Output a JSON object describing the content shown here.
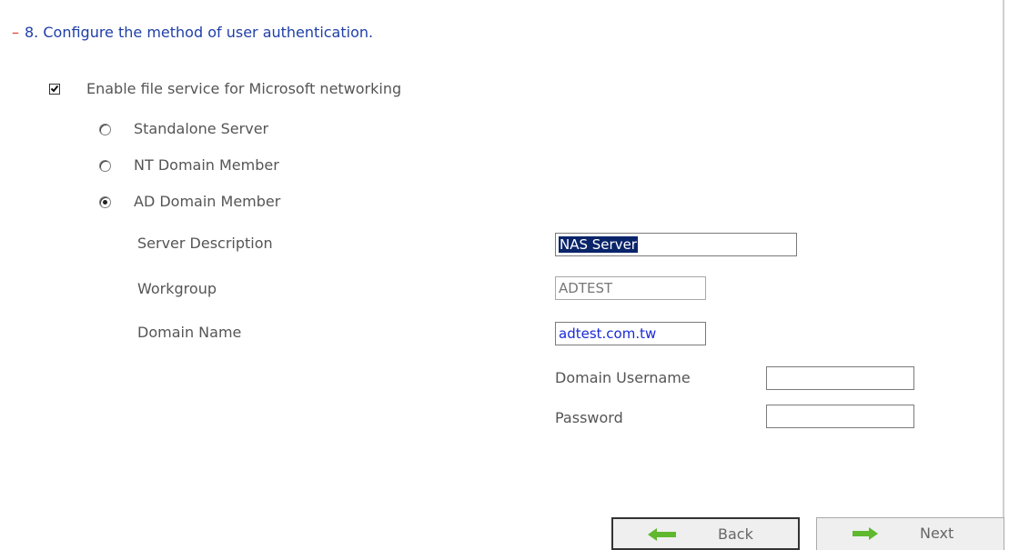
{
  "header": {
    "dash": "–",
    "title": "8. Configure the method of user authentication."
  },
  "file_service": {
    "label": "Enable file service for Microsoft networking",
    "checked": true
  },
  "auth_modes": [
    {
      "label": "Standalone Server",
      "selected": false
    },
    {
      "label": "NT Domain Member",
      "selected": false
    },
    {
      "label": "AD Domain Member",
      "selected": true
    }
  ],
  "fields": {
    "server_description": {
      "label": "Server Description",
      "value": "NAS Server"
    },
    "workgroup": {
      "label": "Workgroup",
      "value": "ADTEST"
    },
    "domain_name": {
      "label": "Domain Name",
      "value": "adtest.com.tw"
    },
    "domain_username": {
      "label": "Domain Username",
      "value": ""
    },
    "password": {
      "label": "Password",
      "value": ""
    }
  },
  "buttons": {
    "back": "Back",
    "next": "Next"
  },
  "colors": {
    "title": "#1f3fa8",
    "dash": "#e03a2c",
    "arrow": "#5fb82e",
    "selection": "#0a246a"
  },
  "icons": {
    "back": "left-arrow-icon",
    "next": "right-arrow-icon"
  }
}
